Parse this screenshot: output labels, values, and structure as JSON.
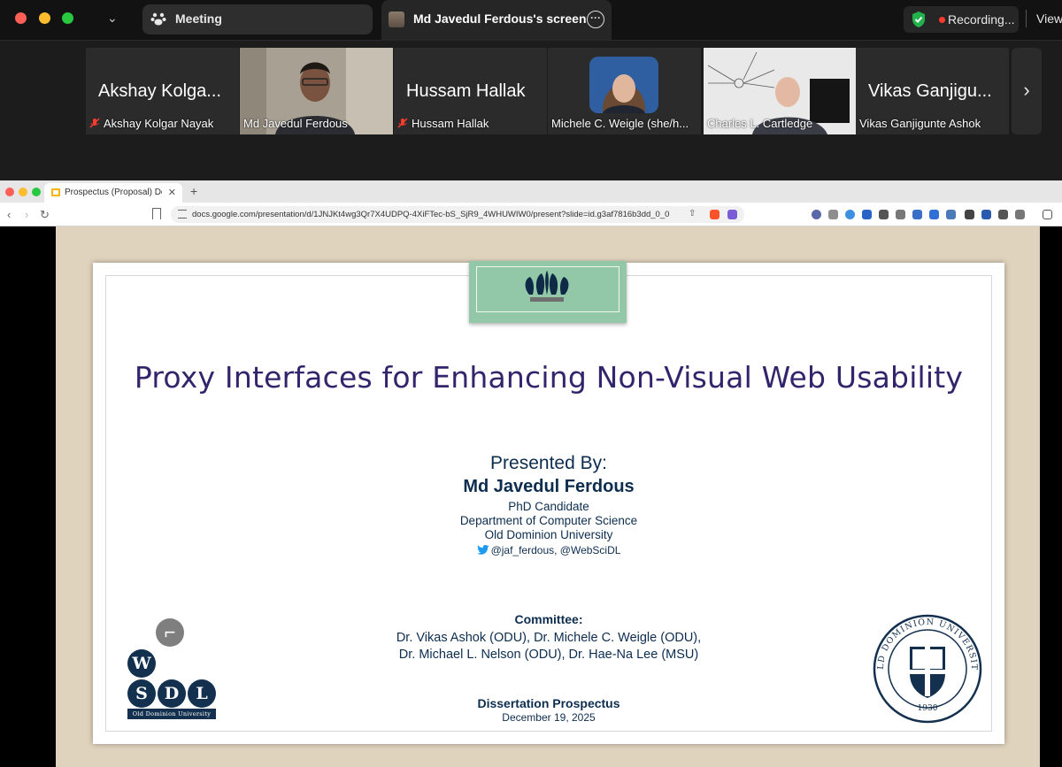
{
  "zoom": {
    "meeting_tab": "Meeting",
    "screen_tab": "Md Javedul Ferdous's screen",
    "recording": "Recording...",
    "view": "View"
  },
  "participants": [
    {
      "display": "Akshay Kolga...",
      "caption": "Akshay Kolgar Nayak",
      "muted": true,
      "video": false
    },
    {
      "display": "",
      "caption": "Md Javedul Ferdous",
      "muted": false,
      "video": true
    },
    {
      "display": "Hussam Hallak",
      "caption": "Hussam Hallak",
      "muted": true,
      "video": false
    },
    {
      "display": "",
      "caption": "Michele C. Weigle (she/h...",
      "muted": false,
      "video": true,
      "active": true
    },
    {
      "display": "",
      "caption": "Charles L. Cartledge",
      "muted": false,
      "video": true
    },
    {
      "display": "Vikas Ganjigu...",
      "caption": "Vikas Ganjigunte Ashok",
      "muted": false,
      "video": false
    }
  ],
  "browser": {
    "tab_title": "Prospectus (Proposal) Defense",
    "url": "docs.google.com/presentation/d/1JNJKt4wg3Qr7X4UDPQ-4XiFTec-bS_SjR9_4WHUWIW0/present?slide=id.g3af7816b3dd_0_0"
  },
  "slide": {
    "title": "Proxy Interfaces for Enhancing Non-Visual Web Usability",
    "presented_by": "Presented By:",
    "presenter": "Md Javedul Ferdous",
    "degree": "PhD Candidate",
    "department": "Department of Computer Science",
    "university": "Old Dominion University",
    "social": "@jaf_ferdous, @WebSciDL",
    "committee_label": "Committee:",
    "committee_line1": "Dr. Vikas Ashok (ODU), Dr. Michele C. Weigle (ODU),",
    "committee_line2": "Dr. Michael L. Nelson (ODU), Dr. Hae-Na Lee (MSU)",
    "doc_type": "Dissertation Prospectus",
    "date": "December 19, 2025",
    "logo_letters": [
      "W",
      "S",
      "D",
      "L"
    ],
    "logo_text": "Old Dominion University",
    "seal_text": "OLD DOMINION UNIVERSITY",
    "seal_year": "1930"
  },
  "colors": {
    "title": "#33246b",
    "body": "#0d2d4f",
    "banner": "#92c8a7",
    "slide_bg": "#dfd3bd",
    "active_speaker": "#35c759"
  }
}
